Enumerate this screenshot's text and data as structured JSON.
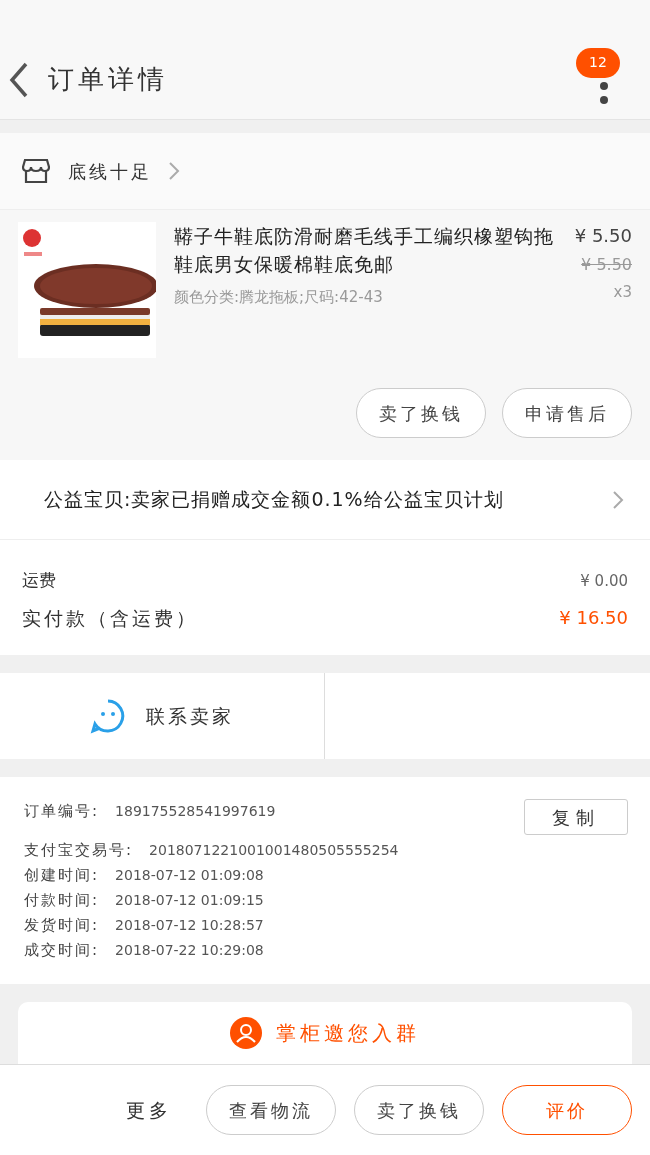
{
  "header": {
    "title": "订单详情",
    "badge": "12"
  },
  "shop": {
    "name": "底线十足"
  },
  "product": {
    "title": "鞯子牛鞋底防滑耐磨毛线手工编织橡塑钩拖鞋底男女保暖棉鞋底免邮",
    "sku": "颜色分类:腾龙拖板;尺码:42-43",
    "price": "¥ 5.50",
    "original_price": "¥ 5.50",
    "quantity": "x3",
    "actions": [
      "卖了换钱",
      "申请售后"
    ]
  },
  "charity": {
    "text": "公益宝贝:卖家已捐赠成交金额0.1%给公益宝贝计划"
  },
  "fees": [
    {
      "label": "运费",
      "value": "¥ 0.00",
      "kind": "normal"
    },
    {
      "label": "实付款（含运费）",
      "value": "¥ 16.50",
      "kind": "total"
    }
  ],
  "contact": {
    "label": "联系卖家"
  },
  "order_info": {
    "copy_button": "复制",
    "rows": [
      {
        "label": "订单编号:",
        "value": "189175528541997619"
      },
      {
        "label": "支付宝交易号:",
        "value": "2018071221001001480505555254"
      },
      {
        "label": "创建时间:",
        "value": "2018-07-12 01:09:08"
      },
      {
        "label": "付款时间:",
        "value": "2018-07-12 01:09:15"
      },
      {
        "label": "发货时间:",
        "value": "2018-07-12 10:28:57"
      },
      {
        "label": "成交时间:",
        "value": "2018-07-22 10:29:08"
      }
    ]
  },
  "group_invite": {
    "label": "掌柜邀您入群"
  },
  "bottom_bar": {
    "more": "更多",
    "buttons": [
      {
        "label": "查看物流",
        "kind": "outline"
      },
      {
        "label": "卖了换钱",
        "kind": "outline"
      },
      {
        "label": "评价",
        "kind": "primary"
      }
    ]
  }
}
